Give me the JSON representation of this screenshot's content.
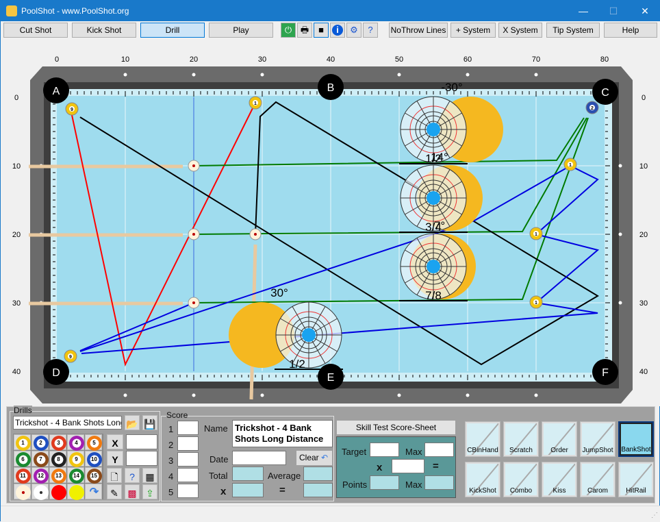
{
  "window": {
    "title": "PoolShot - www.PoolShot.org",
    "minimize": "—",
    "maximize": "☐",
    "close": "✕"
  },
  "toolbar": {
    "buttons": [
      {
        "label": "Cut Shot"
      },
      {
        "label": "Kick Shot"
      },
      {
        "label": "Drill",
        "selected": true
      },
      {
        "label": "Play"
      }
    ],
    "icons": [
      "power-icon",
      "printer-icon",
      "camera-icon",
      "info-icon",
      "gear-icon",
      "help-document-icon"
    ],
    "buttons2": [
      {
        "label": "NoThrow Lines"
      },
      {
        "label": "+ System"
      },
      {
        "label": "X System"
      },
      {
        "label": "Tip System"
      },
      {
        "label": "Help"
      }
    ]
  },
  "table": {
    "x_ruler": [
      "0",
      "10",
      "20",
      "30",
      "40",
      "50",
      "60",
      "70",
      "80"
    ],
    "y_ruler": [
      "0",
      "10",
      "20",
      "30",
      "40"
    ],
    "pockets": [
      "A",
      "B",
      "C",
      "D",
      "E",
      "F"
    ],
    "angle_labels": [
      "-30°",
      "14°",
      "7°",
      "30°"
    ],
    "fraction_labels": [
      "1/2",
      "3/4",
      "7/8",
      "1/2"
    ],
    "cloth_color": "#9fdcee",
    "rail_color": "#6b6b6b",
    "line_colors": {
      "red": "#ff0000",
      "green": "#007a00",
      "black": "#000000",
      "blue": "#0000e0"
    }
  },
  "drills": {
    "legend": "Drills",
    "selected_drill": "Trickshot - 4 Bank Shots Long D",
    "balls": [
      "1",
      "2",
      "3",
      "4",
      "5",
      "6",
      "7",
      "8",
      "9",
      "10",
      "11",
      "12",
      "13",
      "14",
      "15"
    ],
    "x_label": "X",
    "y_label": "Y",
    "x_value": "",
    "y_value": ""
  },
  "score": {
    "legend": "Score",
    "rows": [
      "1",
      "2",
      "3",
      "4",
      "5"
    ],
    "name_label": "Name",
    "name_value": "Trickshot - 4 Bank Shots Long Distance",
    "date_label": "Date",
    "date_value": "",
    "clear_label": "Clear",
    "total_label": "Total",
    "average_label": "Average",
    "x_label": "x",
    "eq_label": "="
  },
  "skill": {
    "title": "Skill Test Score-Sheet",
    "target_label": "Target",
    "max_label": "Max",
    "x_label": "x",
    "eq_label": "=",
    "points_label": "Points",
    "max2_label": "Max"
  },
  "shot_types": [
    {
      "label": "CBinHand"
    },
    {
      "label": "Scratch"
    },
    {
      "label": "Order"
    },
    {
      "label": "JumpShot"
    },
    {
      "label": "BankShot",
      "selected": true
    },
    {
      "label": "KickShot"
    },
    {
      "label": "Combo"
    },
    {
      "label": "Kiss"
    },
    {
      "label": "Carom"
    },
    {
      "label": "HitRail"
    }
  ]
}
